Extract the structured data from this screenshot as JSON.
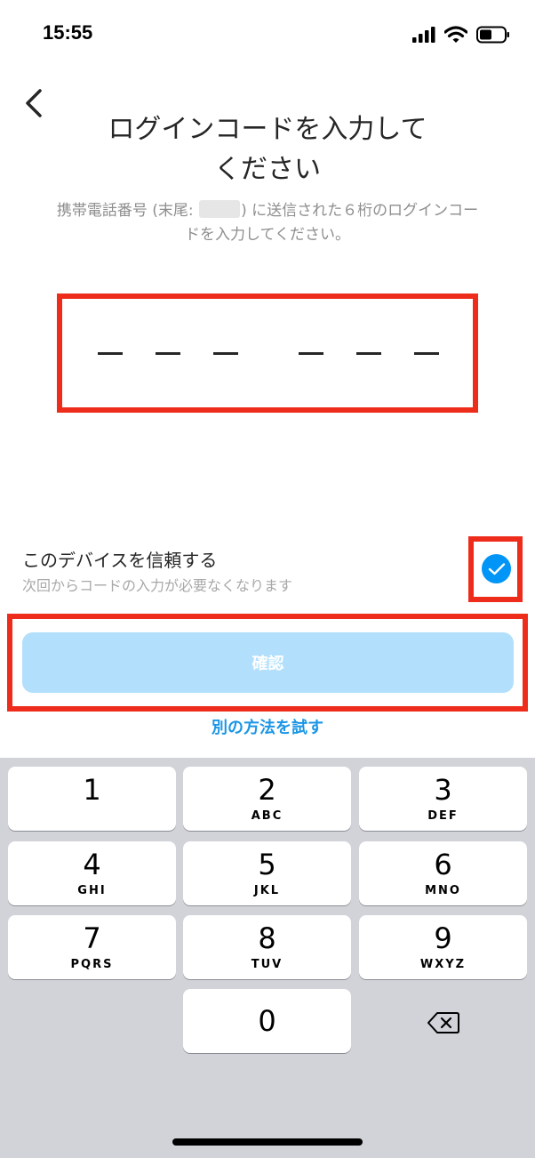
{
  "status": {
    "time": "15:55",
    "icons": [
      "signal-icon",
      "wifi-icon",
      "battery-icon"
    ]
  },
  "header": {
    "back_icon": "chevron-left-icon",
    "title_line1": "ログインコードを入力して",
    "title_line2": "ください",
    "subtitle_part1": "携帯電話番号 (末尾: ",
    "subtitle_part2": ") に送信された６桁のログインコー",
    "subtitle_line2": "ドを入力してください。"
  },
  "code": {
    "length": 6,
    "value": ""
  },
  "trust": {
    "label": "このデバイスを信頼する",
    "description": "次回からコードの入力が必要なくなります",
    "checked": true
  },
  "actions": {
    "confirm_label": "確認",
    "alt_method_label": "別の方法を試す"
  },
  "keyboard": {
    "keys": [
      {
        "num": "1",
        "letters": ""
      },
      {
        "num": "2",
        "letters": "ABC"
      },
      {
        "num": "3",
        "letters": "DEF"
      },
      {
        "num": "4",
        "letters": "GHI"
      },
      {
        "num": "5",
        "letters": "JKL"
      },
      {
        "num": "6",
        "letters": "MNO"
      },
      {
        "num": "7",
        "letters": "PQRS"
      },
      {
        "num": "8",
        "letters": "TUV"
      },
      {
        "num": "9",
        "letters": "WXYZ"
      },
      {
        "num": "0",
        "letters": ""
      }
    ],
    "delete_icon": "backspace-icon"
  },
  "colors": {
    "accent": "#0095f6",
    "button_disabled": "#b2dffc",
    "highlight_frame": "#ee2c1b",
    "link": "#1b96e6"
  }
}
